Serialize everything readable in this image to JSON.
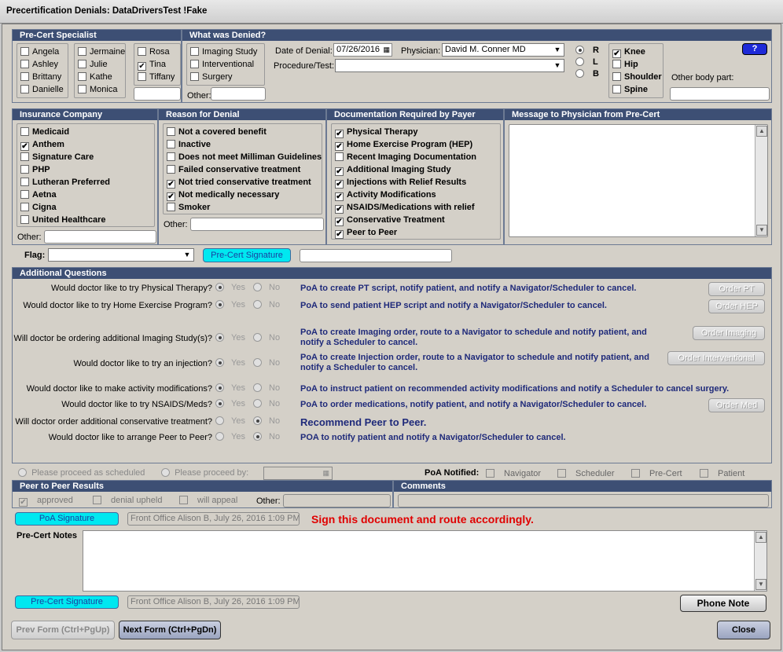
{
  "window": {
    "title": "Precertification Denials:  DataDriversTest !Fake"
  },
  "specialist": {
    "header": "Pre-Cert Specialist",
    "col1": [
      {
        "label": "Angela",
        "checked": false
      },
      {
        "label": "Ashley",
        "checked": false
      },
      {
        "label": "Brittany",
        "checked": false
      },
      {
        "label": "Danielle",
        "checked": false
      }
    ],
    "col2": [
      {
        "label": "Jermaine",
        "checked": false
      },
      {
        "label": "Julie",
        "checked": false
      },
      {
        "label": "Kathe",
        "checked": false
      },
      {
        "label": "Monica",
        "checked": false
      }
    ],
    "col3": [
      {
        "label": "Rosa",
        "checked": false
      },
      {
        "label": "Tina",
        "checked": true
      },
      {
        "label": "Tiffany",
        "checked": false
      }
    ]
  },
  "denied": {
    "header": "What was Denied?",
    "types": [
      {
        "label": "Imaging Study",
        "checked": false
      },
      {
        "label": "Interventional",
        "checked": false
      },
      {
        "label": "Surgery",
        "checked": false
      }
    ],
    "other_label": "Other:",
    "date_label": "Date of Denial:",
    "date_value": "07/26/2016",
    "physician_label": "Physician:",
    "physician_value": "David M. Conner MD",
    "procedure_label": "Procedure/Test:",
    "procedure_value": "",
    "sides": [
      {
        "label": "R",
        "selected": true
      },
      {
        "label": "L",
        "selected": false
      },
      {
        "label": "B",
        "selected": false
      }
    ],
    "body_parts": [
      {
        "label": "Knee",
        "checked": true
      },
      {
        "label": "Hip",
        "checked": false
      },
      {
        "label": "Shoulder",
        "checked": false
      },
      {
        "label": "Spine",
        "checked": false
      }
    ],
    "other_body_label": "Other body part:",
    "help_label": "?"
  },
  "insurance": {
    "header": "Insurance Company",
    "items": [
      {
        "label": "Medicaid",
        "checked": false
      },
      {
        "label": "Anthem",
        "checked": true
      },
      {
        "label": "Signature Care",
        "checked": false
      },
      {
        "label": "PHP",
        "checked": false
      },
      {
        "label": "Lutheran Preferred",
        "checked": false
      },
      {
        "label": "Aetna",
        "checked": false
      },
      {
        "label": "Cigna",
        "checked": false
      },
      {
        "label": "United Healthcare",
        "checked": false
      }
    ],
    "other_label": "Other:"
  },
  "reason": {
    "header": "Reason for Denial",
    "items": [
      {
        "label": "Not a covered benefit",
        "checked": false
      },
      {
        "label": "Inactive",
        "checked": false
      },
      {
        "label": "Does not meet Milliman Guidelines",
        "checked": false
      },
      {
        "label": "Failed conservative treatment",
        "checked": false
      },
      {
        "label": "Not tried conservative treatment",
        "checked": true
      },
      {
        "label": "Not medically necessary",
        "checked": true
      },
      {
        "label": "Smoker",
        "checked": false
      }
    ],
    "other_label": "Other:"
  },
  "documentation": {
    "header": "Documentation Required by Payer",
    "items": [
      {
        "label": "Physical Therapy",
        "checked": true
      },
      {
        "label": "Home Exercise Program (HEP)",
        "checked": true
      },
      {
        "label": "Recent Imaging Documentation",
        "checked": false
      },
      {
        "label": "Additional Imaging Study",
        "checked": true
      },
      {
        "label": "Injections with Relief Results",
        "checked": true
      },
      {
        "label": "Activity Modifications",
        "checked": true
      },
      {
        "label": "NSAIDS/Medications with relief",
        "checked": true
      },
      {
        "label": "Conservative Treatment",
        "checked": true
      },
      {
        "label": "Peer to Peer",
        "checked": true
      }
    ]
  },
  "message": {
    "header": "Message to Physician from Pre-Cert"
  },
  "flag": {
    "label": "Flag:",
    "sig_button": "Pre-Cert Signature"
  },
  "questions": {
    "header": "Additional Questions",
    "yes": "Yes",
    "no": "No",
    "items": [
      {
        "q": "Would doctor like to try Physical Therapy?",
        "answer": "yes",
        "poa": "PoA to create PT script, notify patient, and notify a Navigator/Scheduler to cancel.",
        "button": "Order PT"
      },
      {
        "q": "Would doctor like to try Home Exercise Program?",
        "answer": "yes",
        "poa": "PoA to send patient HEP script and notify a Navigator/Scheduler to cancel.",
        "button": "Order HEP"
      },
      {
        "q": "Will doctor be ordering additional Imaging Study(s)?",
        "answer": "yes",
        "poa": "PoA to create Imaging order, route to a Navigator to schedule and notify patient, and notify a Scheduler to cancel.",
        "button": "Order Imaging"
      },
      {
        "q": "Would doctor like to try an injection?",
        "answer": "yes",
        "poa": "PoA to create Injection order, route to a Navigator to schedule and notify patient, and notify a Scheduler to cancel.",
        "button": "Order Interventional"
      },
      {
        "q": "Would doctor like to make activity modifications?",
        "answer": "yes",
        "poa": "PoA to instruct patient on recommended activity modifications and notify a Scheduler to cancel surgery.",
        "button": ""
      },
      {
        "q": "Would doctor like to try NSAIDS/Meds?",
        "answer": "yes",
        "poa": "PoA to order medications, notify patient, and notify a Navigator/Scheduler to cancel.",
        "button": "Order Med"
      },
      {
        "q": "Will doctor order additional conservative treatment?",
        "answer": "no",
        "poa": "Recommend Peer to Peer.",
        "button": ""
      },
      {
        "q": "Would doctor like to arrange Peer to Peer?",
        "answer": "no",
        "poa": "POA to notify patient and notify a Navigator/Scheduler to cancel.",
        "button": ""
      }
    ]
  },
  "proceed": {
    "scheduled": "Please proceed as scheduled",
    "by": "Please proceed by:",
    "notified_label": "PoA Notified:",
    "notified": [
      "Navigator",
      "Scheduler",
      "Pre-Cert",
      "Patient"
    ]
  },
  "peer": {
    "header": "Peer to Peer Results",
    "items": [
      {
        "label": "approved",
        "checked": true
      },
      {
        "label": "denial upheld",
        "checked": false
      },
      {
        "label": "will appeal",
        "checked": false
      }
    ],
    "other_label": "Other:"
  },
  "comments": {
    "header": "Comments"
  },
  "poa_sig": {
    "button": "PoA Signature",
    "value": "Front Office Alison B,  July 26, 2016 1:09 PM",
    "warning": "Sign this document and route accordingly."
  },
  "notes": {
    "label": "Pre-Cert Notes"
  },
  "precert_sig": {
    "button": "Pre-Cert Signature",
    "value": "Front Office Alison B,  July 26, 2016 1:09 PM"
  },
  "footer": {
    "phone_note": "Phone Note",
    "prev": "Prev Form (Ctrl+PgUp)",
    "next": "Next Form (Ctrl+PgDn)",
    "close": "Close"
  }
}
